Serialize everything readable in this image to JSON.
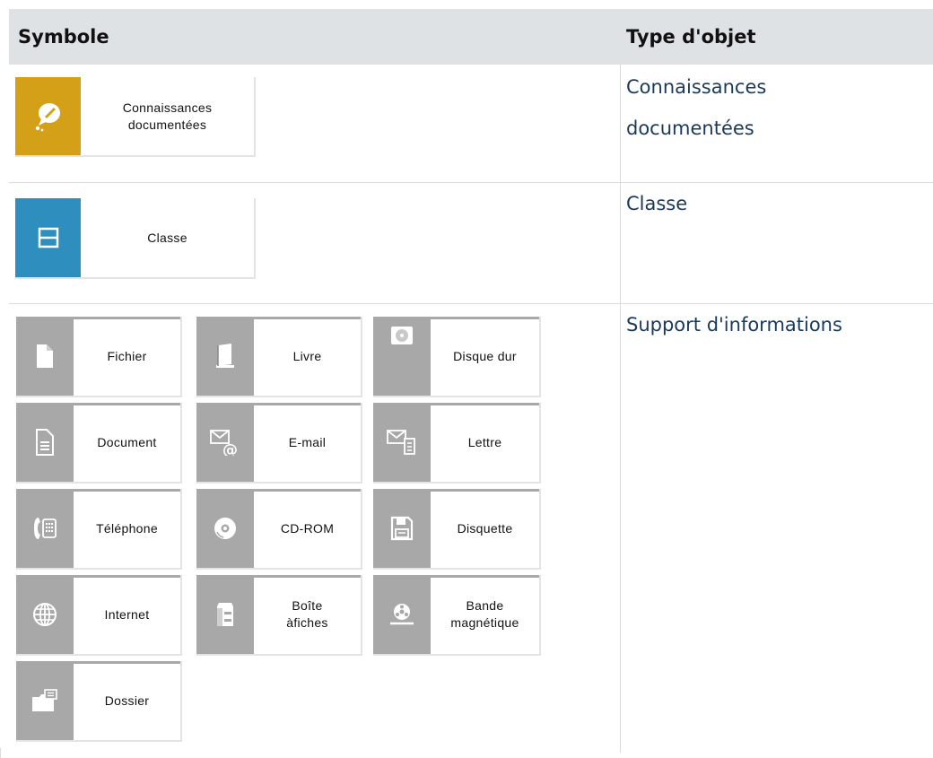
{
  "table": {
    "col_symbol": "Symbole",
    "col_type": "Type d'objet"
  },
  "rows": [
    {
      "type_line1": "Connaissances",
      "type_line2": "documentées",
      "symbol": {
        "label_line1": "Connaissances",
        "label_line2": "documentées",
        "color": "#d4a017",
        "icon": "bulb-icon"
      }
    },
    {
      "type": "Classe",
      "symbol": {
        "label": "Classe",
        "color": "#2e8fbf",
        "icon": "class-icon"
      }
    },
    {
      "type": "Support d'informations",
      "symbols": [
        {
          "label": "Fichier",
          "icon": "file-icon"
        },
        {
          "label": "Livre",
          "icon": "book-icon"
        },
        {
          "label": "Disque dur",
          "icon": "hard-disk-icon"
        },
        {
          "label": "Document",
          "icon": "document-icon"
        },
        {
          "label": "E-mail",
          "icon": "email-icon"
        },
        {
          "label": "Lettre",
          "icon": "letter-icon"
        },
        {
          "label": "Téléphone",
          "icon": "telephone-icon"
        },
        {
          "label": "CD-ROM",
          "icon": "cdrom-icon"
        },
        {
          "label": "Disquette",
          "icon": "floppy-icon"
        },
        {
          "label": "Internet",
          "icon": "globe-icon"
        },
        {
          "label_line1": "Boîte",
          "label_line2": "àfiches",
          "icon": "card-box-icon"
        },
        {
          "label_line1": "Bande",
          "label_line2": "magnétique",
          "icon": "tape-icon"
        },
        {
          "label": "Dossier",
          "icon": "folder-icon"
        }
      ],
      "band_color": "#a8a8a8"
    }
  ]
}
